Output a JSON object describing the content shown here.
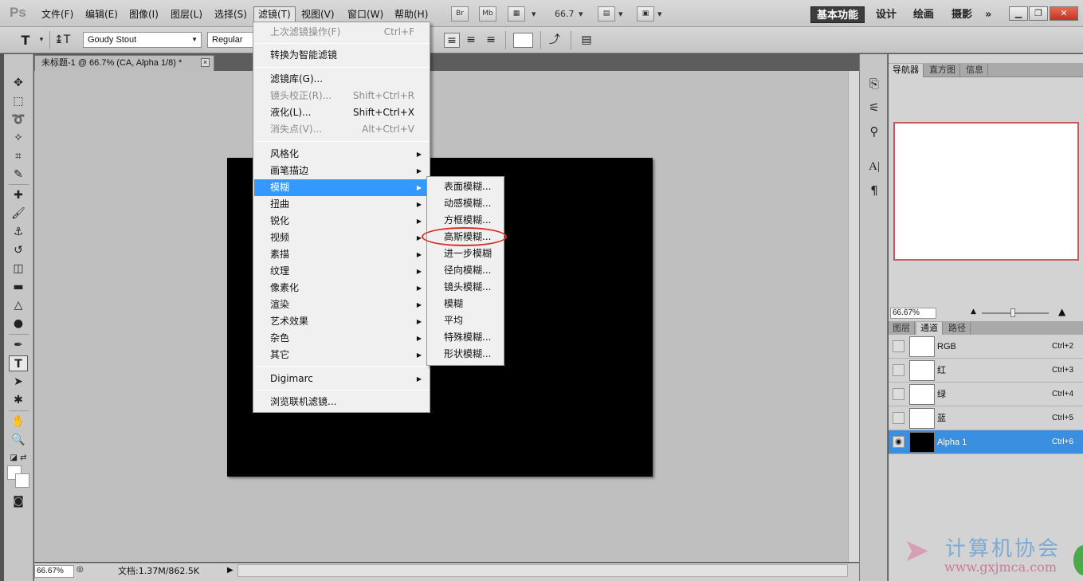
{
  "app": {
    "logo": "Ps"
  },
  "menubar": {
    "items": [
      "文件(F)",
      "编辑(E)",
      "图像(I)",
      "图层(L)",
      "选择(S)",
      "滤镜(T)",
      "视图(V)",
      "窗口(W)",
      "帮助(H)"
    ],
    "bridge_btn": "Br",
    "minibridge_btn": "Mb",
    "zoom_value": "66.7",
    "workspaces": [
      "基本功能",
      "设计",
      "绘画",
      "摄影"
    ],
    "more": "»"
  },
  "options": {
    "font_family": "Goudy Stout",
    "font_style": "Regular"
  },
  "document": {
    "tab_title": "未标题-1 @ 66.7% (CA, Alpha 1/8) *",
    "close": "×"
  },
  "status": {
    "zoom": "66.67%",
    "doc_info": "文档:1.37M/862.5K"
  },
  "filter_menu": {
    "items": [
      {
        "label": "上次滤镜操作(F)",
        "shortcut": "Ctrl+F",
        "disabled": true
      },
      {
        "label": "转换为智能滤镜"
      },
      {
        "label": "滤镜库(G)..."
      },
      {
        "label": "镜头校正(R)...",
        "shortcut": "Shift+Ctrl+R",
        "disabled": true
      },
      {
        "label": "液化(L)...",
        "shortcut": "Shift+Ctrl+X"
      },
      {
        "label": "消失点(V)...",
        "shortcut": "Alt+Ctrl+V",
        "disabled": true
      },
      {
        "label": "风格化"
      },
      {
        "label": "画笔描边"
      },
      {
        "label": "模糊"
      },
      {
        "label": "扭曲"
      },
      {
        "label": "锐化"
      },
      {
        "label": "视频"
      },
      {
        "label": "素描"
      },
      {
        "label": "纹理"
      },
      {
        "label": "像素化"
      },
      {
        "label": "渲染"
      },
      {
        "label": "艺术效果"
      },
      {
        "label": "杂色"
      },
      {
        "label": "其它"
      },
      {
        "label": "Digimarc"
      },
      {
        "label": "浏览联机滤镜..."
      }
    ]
  },
  "blur_menu": {
    "items": [
      "表面模糊...",
      "动感模糊...",
      "方框模糊...",
      "高斯模糊...",
      "进一步模糊",
      "径向模糊...",
      "镜头模糊...",
      "模糊",
      "平均",
      "特殊模糊...",
      "形状模糊..."
    ]
  },
  "panels": {
    "top_tabs": [
      "导航器",
      "直方图",
      "信息"
    ],
    "nav_zoom": "66.67%",
    "bottom_tabs": [
      "图层",
      "通道",
      "路径"
    ],
    "channels": [
      {
        "name": "RGB",
        "shortcut": "Ctrl+2"
      },
      {
        "name": "红",
        "shortcut": "Ctrl+3"
      },
      {
        "name": "绿",
        "shortcut": "Ctrl+4"
      },
      {
        "name": "蓝",
        "shortcut": "Ctrl+5"
      },
      {
        "name": "Alpha 1",
        "shortcut": "Ctrl+6",
        "selected": true
      }
    ]
  },
  "watermark": {
    "text": "计算机协会",
    "url": "www.gxjmca.com"
  },
  "colors": {
    "highlight": "#3399ff",
    "annotation": "#d9302a",
    "selected_row": "#3b8fe0"
  }
}
